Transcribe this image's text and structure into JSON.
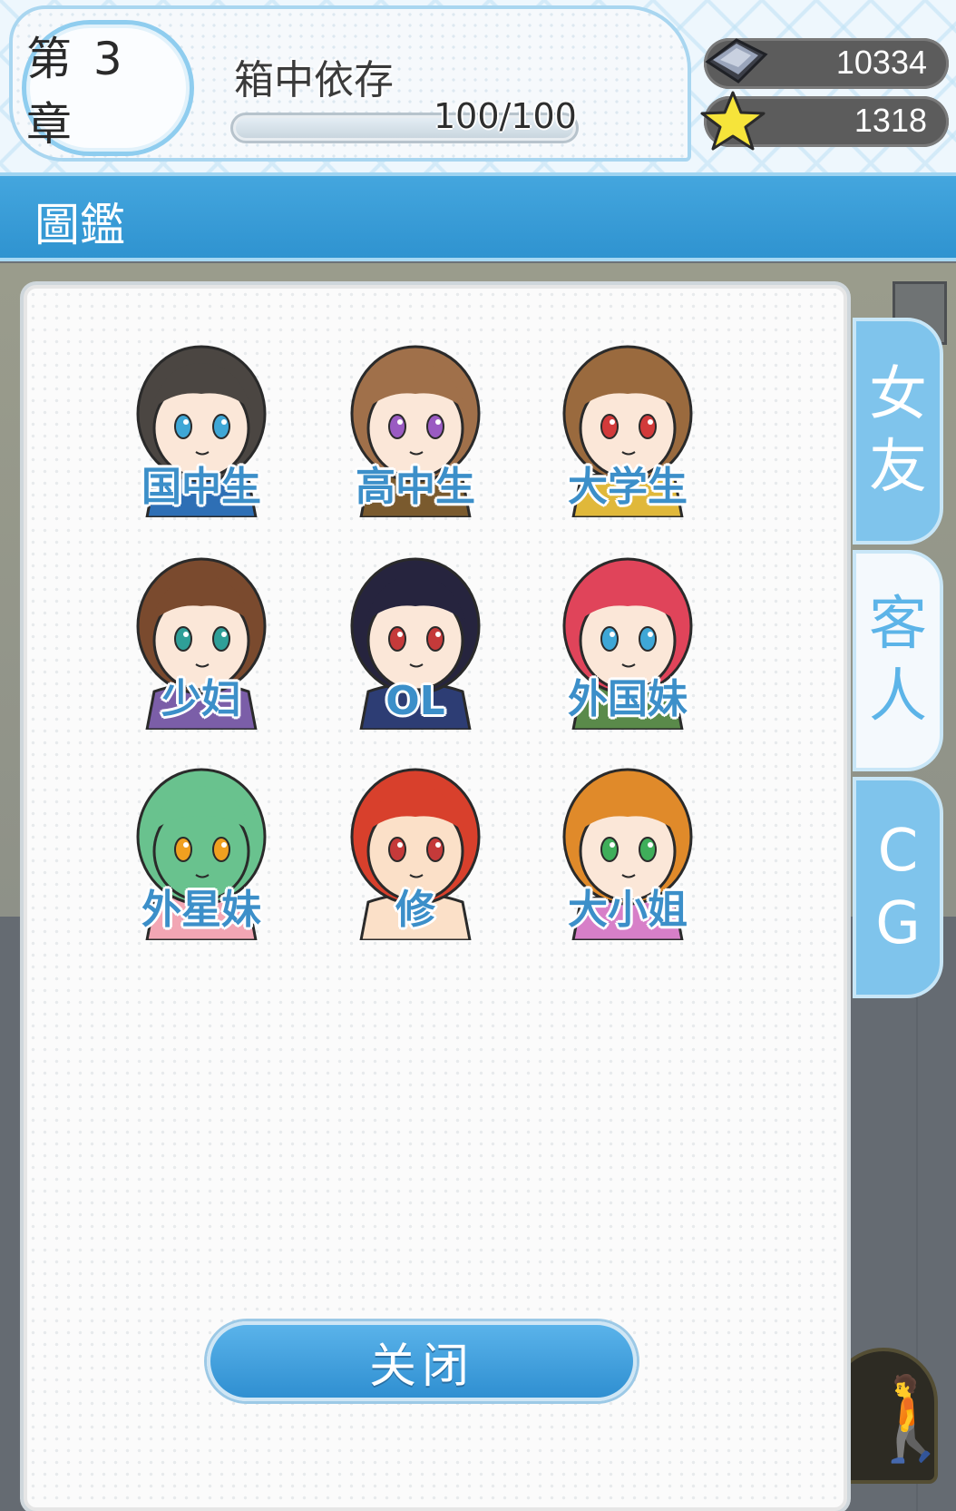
{
  "header": {
    "chapter_label": "第 3 章",
    "chapter_title": "箱中依存",
    "progress_text": "100/100",
    "progress_fraction": 1.0
  },
  "currency": {
    "gems": "10334",
    "stars": "1318"
  },
  "section": {
    "title": "圖鑑"
  },
  "side_tabs": {
    "friends": [
      "女",
      "友"
    ],
    "guests": [
      "客",
      "人"
    ],
    "cg": [
      "C",
      "G"
    ],
    "active": "guests"
  },
  "characters": [
    {
      "name": "国中生",
      "hair": "#4b4642",
      "skin": "#fbe7d8",
      "eye": "#3fa7d6",
      "accent": "#2e6fb5"
    },
    {
      "name": "高中生",
      "hair": "#a0704a",
      "skin": "#fbe7d8",
      "eye": "#9a5bc2",
      "accent": "#7a5a2e"
    },
    {
      "name": "大学生",
      "hair": "#9a6a3e",
      "skin": "#fbe7d8",
      "eye": "#d23a3a",
      "accent": "#e0b83a"
    },
    {
      "name": "少妇",
      "hair": "#7a4a2e",
      "skin": "#fbe7d8",
      "eye": "#2f9f98",
      "accent": "#7b5ea8"
    },
    {
      "name": "OL",
      "hair": "#26243e",
      "skin": "#fbe7d8",
      "eye": "#c53a3a",
      "accent": "#2d3d74"
    },
    {
      "name": "外国妹",
      "hair": "#e0445a",
      "skin": "#fbe7d8",
      "eye": "#3fa7d6",
      "accent": "#5a8a4a"
    },
    {
      "name": "外星妹",
      "hair": "#69c28e",
      "skin": "#69c28e",
      "eye": "#f0a020",
      "accent": "#f2a6b4"
    },
    {
      "name": "修",
      "hair": "#d8402c",
      "skin": "#fbe0c8",
      "eye": "#c53a3a",
      "accent": "#fbe0c8"
    },
    {
      "name": "大小姐",
      "hair": "#e08a2a",
      "skin": "#fbe7d8",
      "eye": "#3fae5a",
      "accent": "#d77fc8"
    }
  ],
  "close_button": {
    "label": "关闭"
  },
  "colors": {
    "accent_blue": "#3c8fc9",
    "header_bar": "#3a9ed8"
  }
}
